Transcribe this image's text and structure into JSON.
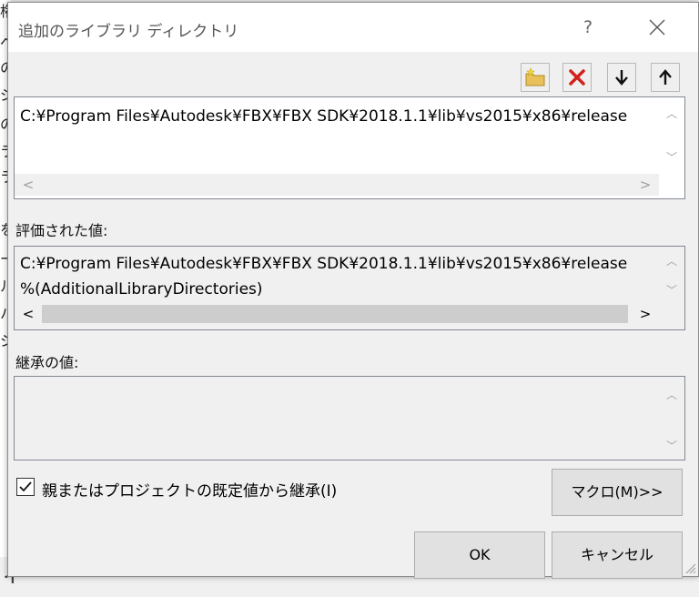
{
  "dialog": {
    "title": "追加のライブラリ ディレクトリ",
    "help_label": "?",
    "close_label": "✕"
  },
  "toolbar": {
    "icons": [
      "new-folder-icon",
      "delete-icon",
      "move-down-icon",
      "move-up-icon"
    ]
  },
  "edit_box": {
    "lines": [
      "C:¥Program Files¥Autodesk¥FBX¥FBX SDK¥2018.1.1¥lib¥vs2015¥x86¥release"
    ],
    "scroll_left": "<",
    "scroll_right": ">"
  },
  "evaluated": {
    "label": "評価された値:",
    "lines": [
      "C:¥Program Files¥Autodesk¥FBX¥FBX SDK¥2018.1.1¥lib¥vs2015¥x86¥release",
      "%(AdditionalLibraryDirectories)"
    ],
    "scroll_left": "<",
    "scroll_right": ">"
  },
  "inherited": {
    "label": "継承の値:"
  },
  "inherit_checkbox": {
    "label": "親またはプロジェクトの既定値から継承(I)",
    "checked": true
  },
  "buttons": {
    "macro": "マクロ(M)>>",
    "ok": "OK",
    "cancel": "キャンセル"
  },
  "background": {
    "left_chars": [
      "権",
      "ペ",
      "の",
      "ジ",
      "の",
      "ラ",
      "ラ",
      "を",
      "ー",
      "ル",
      "ハ",
      "ジ"
    ],
    "bottom_text": "イ"
  }
}
